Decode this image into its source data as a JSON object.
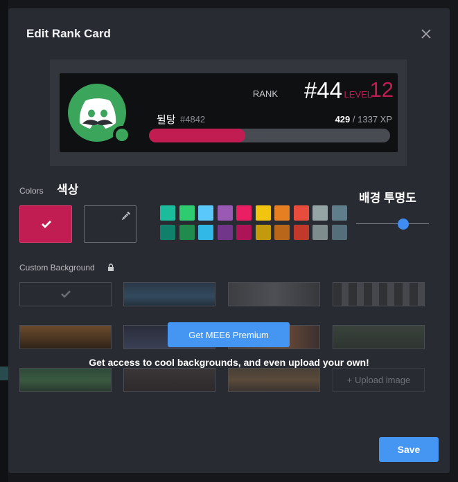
{
  "modal": {
    "title": "Edit Rank Card",
    "close_label": "X"
  },
  "card": {
    "rank_label": "RANK",
    "rank_value": "#44",
    "level_label": "LEVEL",
    "level_value": "12",
    "username": "뒬탕",
    "discriminator": "#4842",
    "xp_current": "429",
    "xp_separator": " / ",
    "xp_total": "1337 XP",
    "xp_progress": 0.4,
    "bar_color": "#c21d53",
    "avatar_color": "#3ba55c"
  },
  "colors": {
    "label": "Colors",
    "annotation": "색상",
    "selected": "#c21d53",
    "palette": [
      "#1abc9c",
      "#2ecc71",
      "#5ac8fa",
      "#9b59b6",
      "#e91e63",
      "#f1c40f",
      "#e67e22",
      "#e74c3c",
      "#95a5a6",
      "#607d8b",
      "#11806a",
      "#1f8b4c",
      "#31b8e6",
      "#71368a",
      "#ad1457",
      "#c29a0c",
      "#b9661a",
      "#c0392b",
      "#7f8c8d",
      "#546e7a"
    ]
  },
  "opacity": {
    "annotation": "배경 투명도",
    "value": 0.65
  },
  "background": {
    "label": "Custom Background",
    "premium_button": "Get MEE6 Premium",
    "premium_note": "Get access to cool backgrounds, and even upload your own!",
    "upload_label": "+ Upload image"
  },
  "footer": {
    "save_label": "Save"
  }
}
